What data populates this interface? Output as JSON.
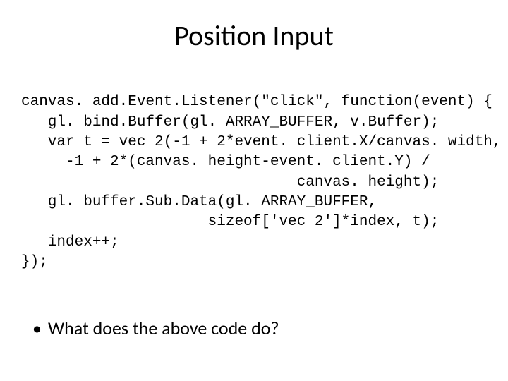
{
  "title": "Position Input",
  "code": {
    "l1": "canvas. add.Event.Listener(\"click\", function(event) {",
    "l2": "   gl. bind.Buffer(gl. ARRAY_BUFFER, v.Buffer);",
    "l3": "   var t = vec 2(-1 + 2*event. client.X/canvas. width,",
    "l4": "     -1 + 2*(canvas. height-event. client.Y) /",
    "l5": "                               canvas. height);",
    "l6": "   gl. buffer.Sub.Data(gl. ARRAY_BUFFER,",
    "l7": "                     sizeof['vec 2']*index, t);",
    "l8": "   index++;",
    "l9": "});"
  },
  "bullet_mark": "•",
  "bullet_text": "What does the above code do?"
}
